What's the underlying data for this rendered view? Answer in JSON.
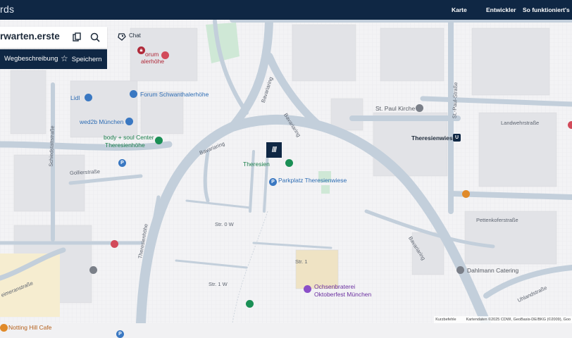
{
  "header": {
    "brand": "rds",
    "nav": [
      "Karte",
      "Entwickler",
      "So funktioniert's"
    ]
  },
  "search": {
    "value": "rwarten.erste",
    "copy_icon": "copy-icon",
    "search_icon": "search-icon"
  },
  "actions": {
    "route_label": "Wegbeschreibung",
    "save_label": "Speichern",
    "chat_label": "Chat"
  },
  "marker": {
    "label": "///"
  },
  "pois": {
    "forum_top": "orum",
    "forum_top2": "alerhöhe",
    "forum": "Forum Schwanthalerhöhe",
    "lidl": "Lidl",
    "wed2b": "wed2b München",
    "body_soul_1": "body + soul Center",
    "body_soul_2": "Theresienhöhe",
    "theresien_short": "Theresien",
    "parkplatz": "Parkplatz Theresienwiese",
    "st_paul": "St. Paul Kirche",
    "theresienwiese": "Theresienwiese",
    "ubahn": "U",
    "parking": "P",
    "ochsen_1": "Ochsenbraterei",
    "ochsen_2": "Oktoberfest München",
    "dahlmann": "Dahlmann Catering",
    "notting": "Notting Hill Cafe"
  },
  "streets": {
    "bavariaring_1": "Bavariaring",
    "bavariaring_2": "Bavariaring",
    "bavariaring_3": "Bavariaring",
    "bavariaring_4": "Bavariaring",
    "schiedstatt": "Schiedstattstraße",
    "gollier": "Gollierstraße",
    "theresienhoehe": "Theresienhöhe",
    "st_paul_str": "St.-Paul-Straße",
    "landwehr": "Landwehrstraße",
    "pettenkofer": "Pettenkoferstraße",
    "uhland": "Uhlandstraße",
    "heimeran": "eimeranstraße",
    "str0w": "Str. 0 W",
    "str1": "Str. 1",
    "str1w": "Str. 1 W"
  },
  "attribution": {
    "shortcuts": "Kurzbefehle",
    "data": "Kartendaten ©2025 CDWI, GeoBasis-DE/BKG (©2009), Goo"
  },
  "colors": {
    "header": "#0f2744",
    "road": "#c3cfdb",
    "background": "#f1f1f3",
    "park": "#cfe8d6"
  }
}
